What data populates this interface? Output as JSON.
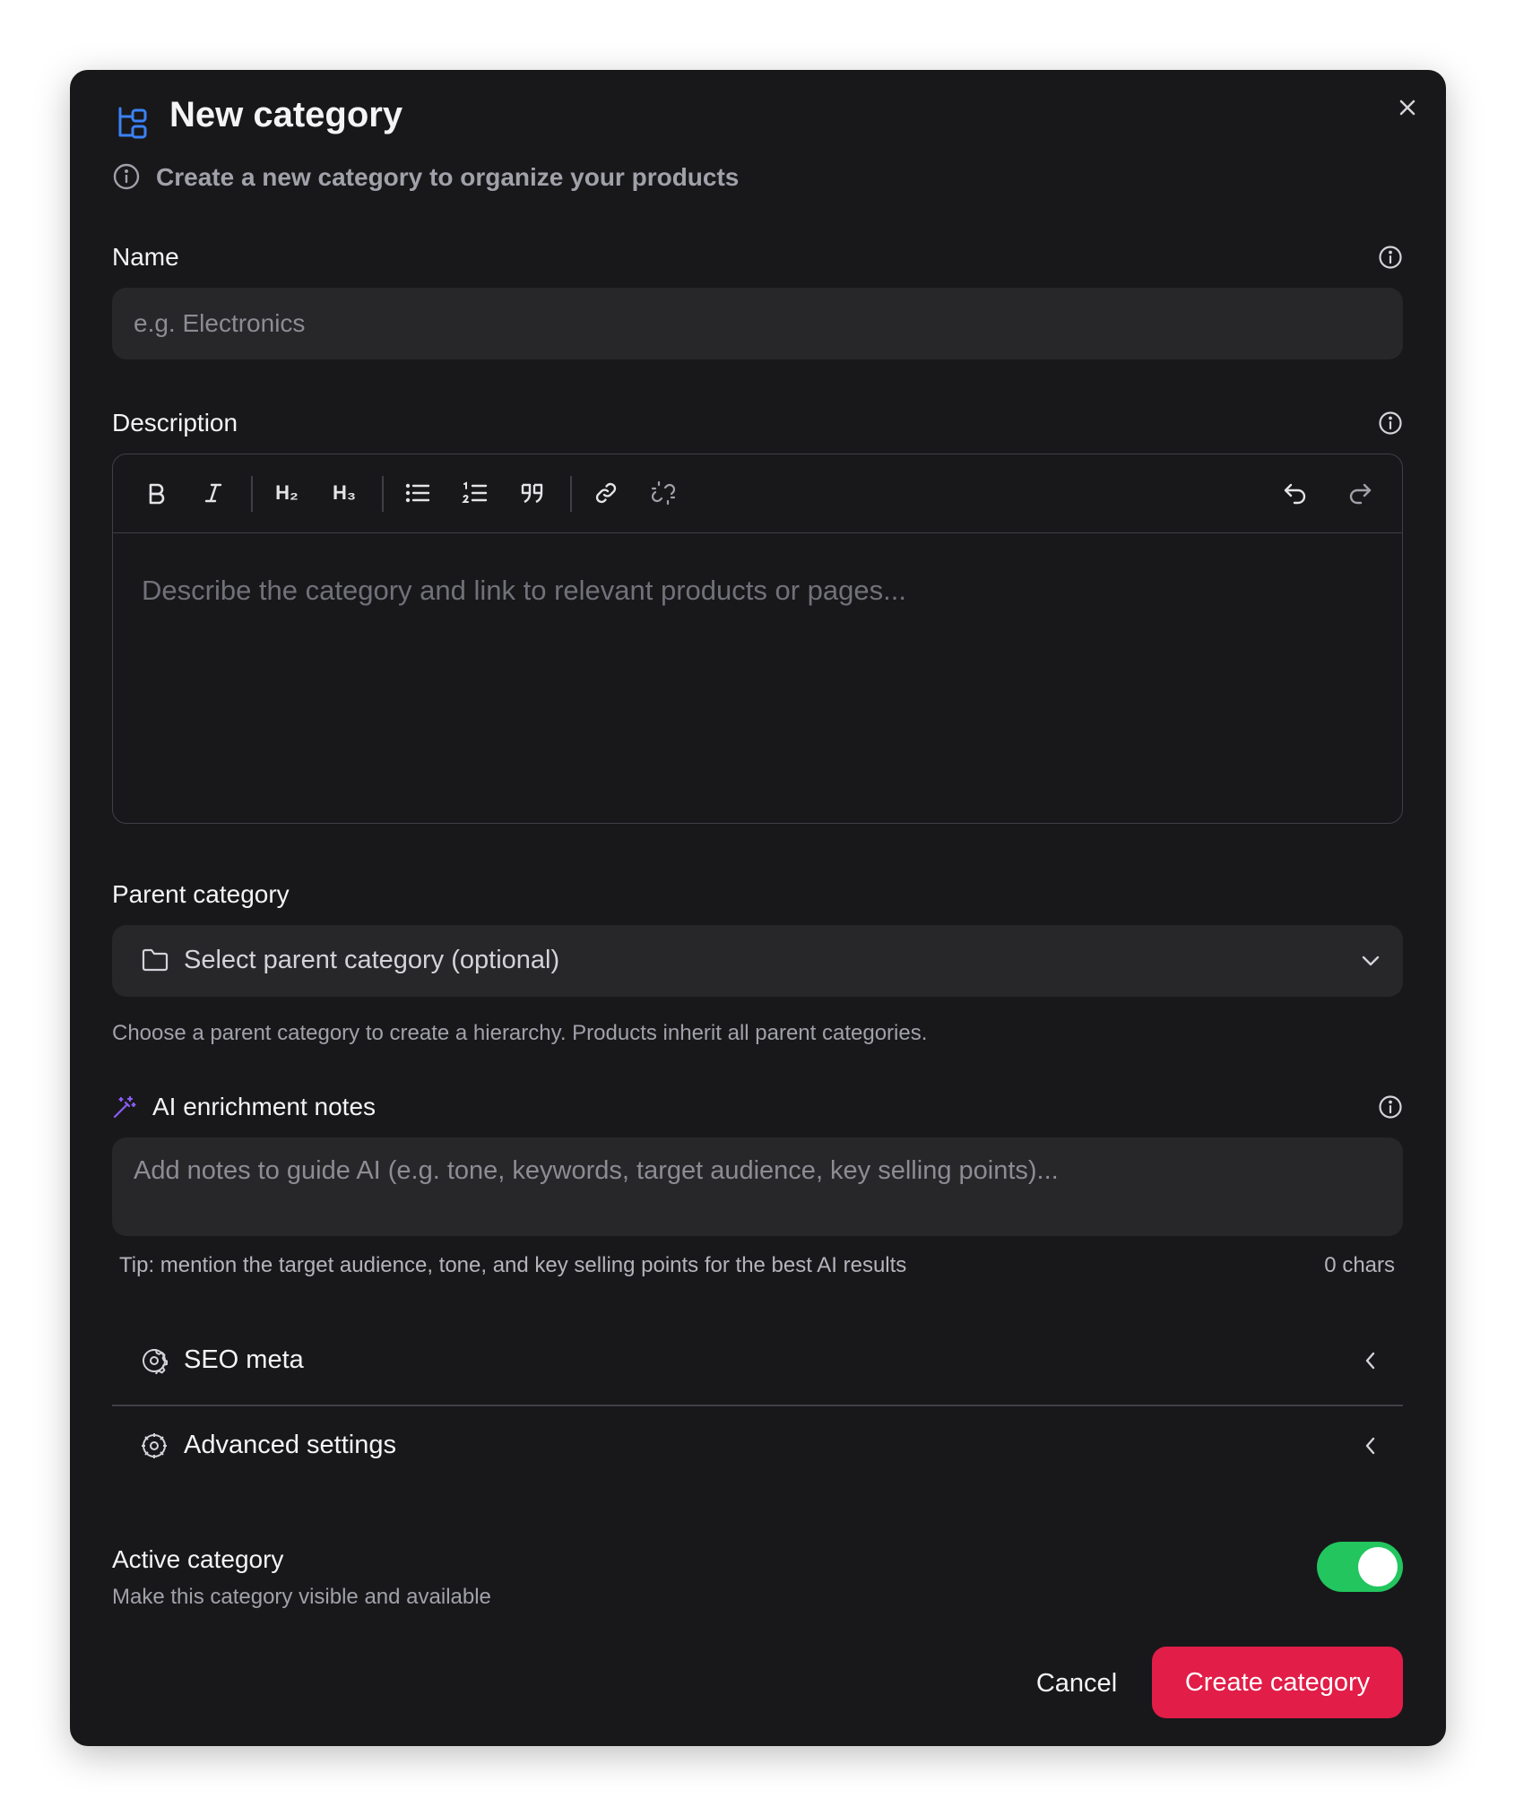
{
  "dialog": {
    "title": "New category",
    "subtitle": "Create a new category to organize your products"
  },
  "name_field": {
    "label": "Name",
    "placeholder": "e.g. Electronics"
  },
  "description_field": {
    "label": "Description",
    "toolbar": {
      "h2": "H₂",
      "h3": "H₃"
    },
    "placeholder": "Describe the category and link to relevant products or pages..."
  },
  "parent_field": {
    "label": "Parent category",
    "placeholder": "Select parent category (optional)",
    "helper": "Choose a parent category to create a hierarchy. Products inherit all parent categories."
  },
  "ai_notes": {
    "label": "AI enrichment notes",
    "placeholder": "Add notes to guide AI (e.g. tone, keywords, target audience, key selling points)...",
    "tip": "Tip: mention the target audience, tone, and key selling points for the best AI results",
    "char_count": "0 chars"
  },
  "sections": [
    {
      "label": "SEO meta"
    },
    {
      "label": "Advanced settings"
    }
  ],
  "active": {
    "label": "Active category",
    "description": "Make this category visible and available",
    "enabled": true
  },
  "actions": {
    "cancel": "Cancel",
    "submit": "Create category"
  },
  "colors": {
    "accent_blue": "#3b82f6",
    "ai_purple": "#8b5cf6",
    "toggle_green": "#22c55e",
    "primary_red": "#e11d48"
  }
}
